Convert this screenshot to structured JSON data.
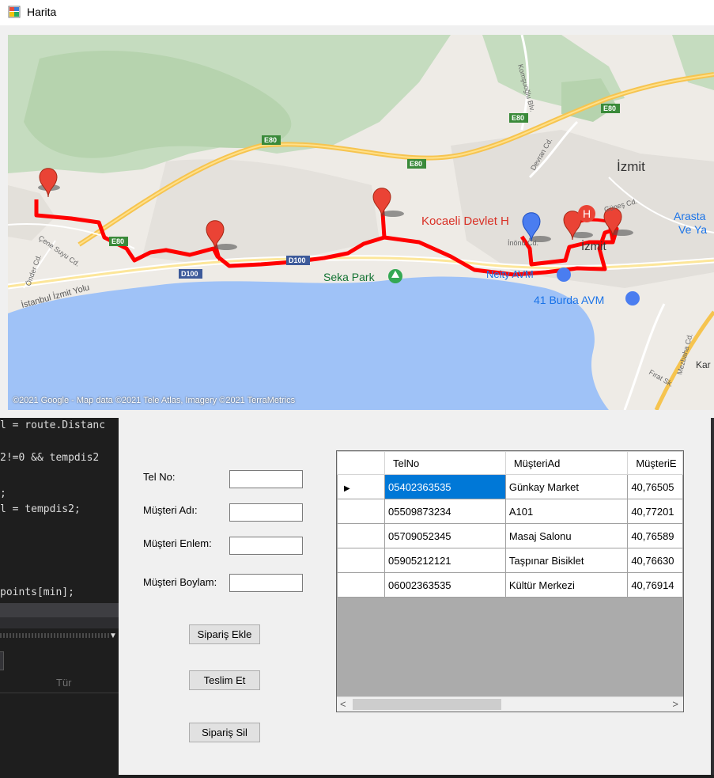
{
  "window": {
    "title": "Harita",
    "icon": "app-form-icon"
  },
  "map": {
    "attribution": "©2021 Google - Map data ©2021 Tele Atlas, Imagery ©2021 TerraMetrics",
    "labels": {
      "izmit": "İzmit",
      "izmit_center": "İzmit",
      "kocaeli_devlet": "Kocaeli Devlet H",
      "arasta": "Arasta",
      "ve_ya": "Ve Ya",
      "seka_park": "Seka Park",
      "neity_avm": "Neity AVM",
      "burda_avm": "41 Burda AVM",
      "istanbul_izmit_yolu": "İstanbul İzmit Yolu",
      "e80_1": "E80",
      "e80_2": "E80",
      "e80_3": "E80",
      "e80_4": "E80",
      "e80_5": "E80",
      "d100_1": "D100",
      "d100_2": "D100",
      "onder_cd": "Önder Cd.",
      "cene_suyu_cd": "Çene Suyu Cd.",
      "komsuoglu_blv": "Komşuoğlu Blv.",
      "devran_cd": "Devran Cd.",
      "mezbaha_cd": "Mezbaha Cd.",
      "firat_sk": "Fırat Sk.",
      "inonu_cd": "İnönü Cd.",
      "gunes_cd": "Güneş Cd.",
      "kar": "Kar"
    },
    "colors": {
      "sea": "#9fc3f7",
      "land": "#f2efe9",
      "green": "#c8dfc0",
      "route": "#ff0000",
      "marker_red": "#ea4335",
      "marker_blue": "#4a7df0",
      "highway": "#f6c44f"
    }
  },
  "ide": {
    "lines": [
      "l = route.Distanc",
      "2!=0 && tempdis2",
      ";",
      "l = tempdis2;",
      "points[min];"
    ],
    "tur_label": "Tür"
  },
  "form": {
    "labels": {
      "tel_no": "Tel No:",
      "musteri_adi": "Müşteri Adı:",
      "musteri_enlem": "Müşteri Enlem:",
      "musteri_boylam": "Müşteri Boylam:"
    },
    "inputs": {
      "tel_no": "",
      "musteri_adi": "",
      "musteri_enlem": "",
      "musteri_boylam": ""
    },
    "buttons": {
      "siparis_ekle": "Sipariş Ekle",
      "teslim_et": "Teslim Et",
      "siparis_sil": "Sipariş Sil"
    }
  },
  "grid": {
    "columns": [
      "TelNo",
      "MüşteriAd",
      "MüşteriE"
    ],
    "rows": [
      {
        "tel": "05402363535",
        "ad": "Günkay Market",
        "enlem": "40,76505"
      },
      {
        "tel": "05509873234",
        "ad": "A101",
        "enlem": "40,77201"
      },
      {
        "tel": "05709052345",
        "ad": "Masaj Salonu",
        "enlem": "40,76589"
      },
      {
        "tel": "05905212121",
        "ad": "Taşpınar Bisiklet",
        "enlem": "40,76630"
      },
      {
        "tel": "06002363535",
        "ad": "Kültür Merkezi",
        "enlem": "40,76914"
      }
    ],
    "selected_row": 0
  }
}
